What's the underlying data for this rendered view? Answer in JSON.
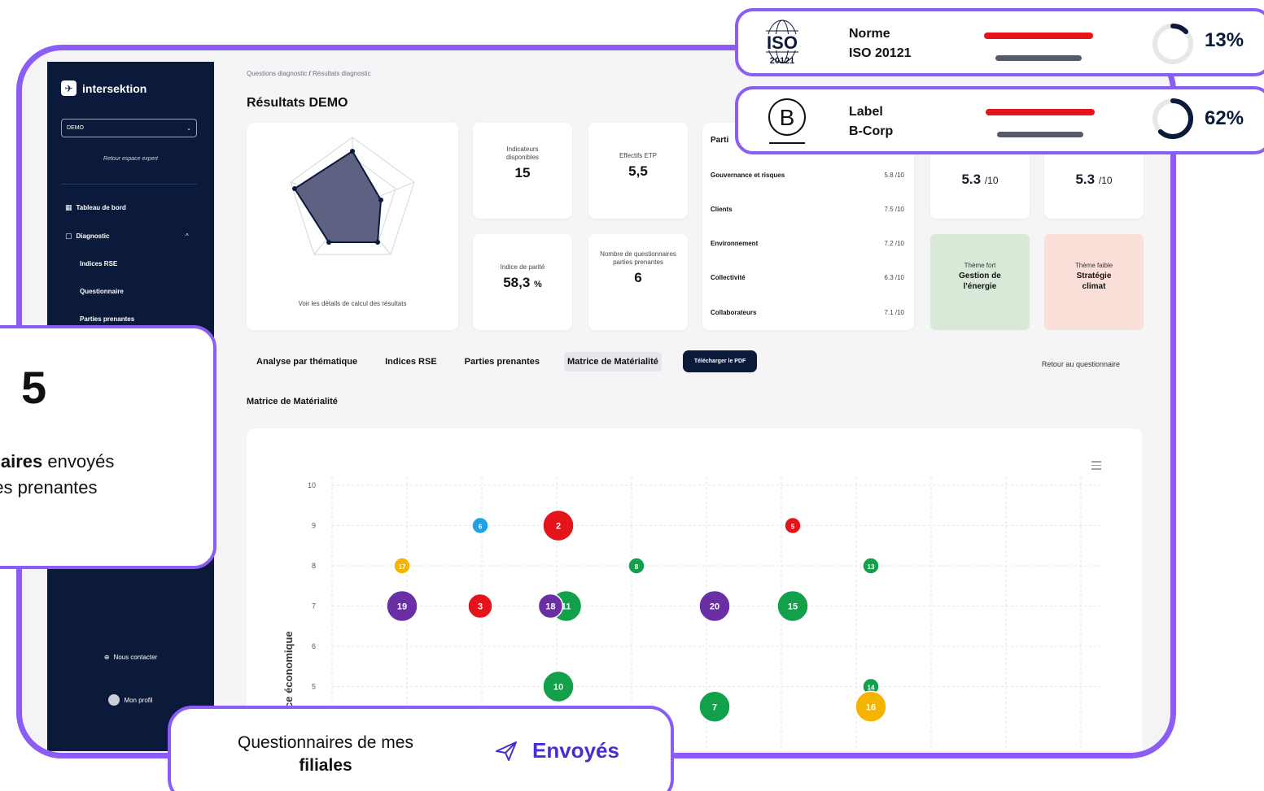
{
  "sidebar": {
    "brand": "intersektion",
    "company_select": "DEMO",
    "back_link": "Retour espace expert",
    "nav": {
      "dashboard": "Tableau de bord",
      "diagnostic": "Diagnostic",
      "indices": "Indices RSE",
      "questionnaire": "Questionnaire",
      "parties": "Parties prenantes"
    },
    "contact": "Nous contacter",
    "profile": "Mon profil"
  },
  "breadcrumb": {
    "first": "Questions diagnostic",
    "separator": "/",
    "current": "Résultats diagnostic"
  },
  "page_title": "Résultats DEMO",
  "radar_link": "Voir les détails de calcul des résultats",
  "kpis": {
    "indicators": {
      "label": "Indicateurs disponibles",
      "value": "15"
    },
    "effectifs": {
      "label": "Effectifs ETP",
      "value": "5,5"
    },
    "parite": {
      "label": "Indice de parité",
      "value": "58,3",
      "unit": "%"
    },
    "questionnaires": {
      "label": "Nombre de questionnaires parties prenantes",
      "value": "6"
    }
  },
  "parties_card": {
    "title": "Parti",
    "rows": [
      {
        "name": "Gouvernance et risques",
        "score": "5.8 /10"
      },
      {
        "name": "Clients",
        "score": "7.5 /10"
      },
      {
        "name": "Environnement",
        "score": "7.2 /10"
      },
      {
        "name": "Collectivité",
        "score": "6.3 /10"
      },
      {
        "name": "Collaborateurs",
        "score": "7.1 /10"
      }
    ]
  },
  "scores": {
    "a": "5.3",
    "a_unit": "/10",
    "b": "5.3",
    "b_unit": "/10"
  },
  "themes": {
    "strong": {
      "label": "Thème fort",
      "value": "Gestion de l'énergie",
      "color": "#d8ead7"
    },
    "weak": {
      "label": "Thème faible",
      "value": "Stratégie climat",
      "color": "#fbe0da"
    }
  },
  "tabs": [
    "Analyse par thématique",
    "Indices RSE",
    "Parties prenantes",
    "Matrice de Matérialité"
  ],
  "pdf_button": "Télécharger le PDF",
  "back_questionnaire": "Retour au questionnaire",
  "matrix_title": "Matrice de Matérialité",
  "chart_data": {
    "type": "scatter",
    "ylabel": "ce économique",
    "ylim": [
      4.5,
      10
    ],
    "y_ticks": [
      5,
      6,
      7,
      8,
      9,
      10
    ],
    "grid": true,
    "points": [
      {
        "label": "6",
        "x": 1.5,
        "y": 9,
        "r": "s",
        "color": "#1ea2e4"
      },
      {
        "label": "2",
        "x": 2.5,
        "y": 9,
        "r": "l",
        "color": "#e5131a"
      },
      {
        "label": "5",
        "x": 5.5,
        "y": 9,
        "r": "s",
        "color": "#e5131a"
      },
      {
        "label": "17",
        "x": 0.5,
        "y": 8,
        "r": "s",
        "color": "#f5b400"
      },
      {
        "label": "8",
        "x": 3.5,
        "y": 8,
        "r": "s",
        "color": "#12a04a"
      },
      {
        "label": "13",
        "x": 6.5,
        "y": 8,
        "r": "s",
        "color": "#12a04a"
      },
      {
        "label": "19",
        "x": 0.5,
        "y": 7,
        "r": "l",
        "color": "#6a2fa5"
      },
      {
        "label": "3",
        "x": 1.5,
        "y": 7,
        "r": "m",
        "color": "#e5131a"
      },
      {
        "label": "11",
        "x": 2.6,
        "y": 7,
        "r": "l",
        "color": "#12a04a"
      },
      {
        "label": "18",
        "x": 2.4,
        "y": 7,
        "r": "m",
        "color": "#6a2fa5"
      },
      {
        "label": "20",
        "x": 4.5,
        "y": 7,
        "r": "l",
        "color": "#6a2fa5"
      },
      {
        "label": "15",
        "x": 5.5,
        "y": 7,
        "r": "l",
        "color": "#12a04a"
      },
      {
        "label": "10",
        "x": 2.5,
        "y": 5,
        "r": "l",
        "color": "#12a04a"
      },
      {
        "label": "14",
        "x": 6.5,
        "y": 5,
        "r": "s",
        "color": "#12a04a"
      },
      {
        "label": "7",
        "x": 4.5,
        "y": 4.5,
        "r": "l",
        "color": "#12a04a"
      },
      {
        "label": "16",
        "x": 6.5,
        "y": 4.5,
        "r": "l",
        "color": "#f5b400"
      }
    ]
  },
  "certifications": [
    {
      "logo": "ISO",
      "logo_sub": "20121",
      "line1": "Norme",
      "line2": "ISO 20121",
      "percent": "13%",
      "progress": 0.13
    },
    {
      "logo": "B",
      "line1": "Label",
      "line2": "B-Corp",
      "percent": "62%",
      "progress": 0.62
    }
  ],
  "left_panel": {
    "number": "5",
    "bold": "nnaires",
    "text1": " envoyés",
    "text2": "rties prenantes"
  },
  "bottom_panel": {
    "text": "Questionnaires de mes",
    "bold": "filiales",
    "status": "Envoyés"
  },
  "colors": {
    "accent": "#8b5cf6",
    "navy": "#0b1a3a",
    "red": "#e5131a"
  }
}
